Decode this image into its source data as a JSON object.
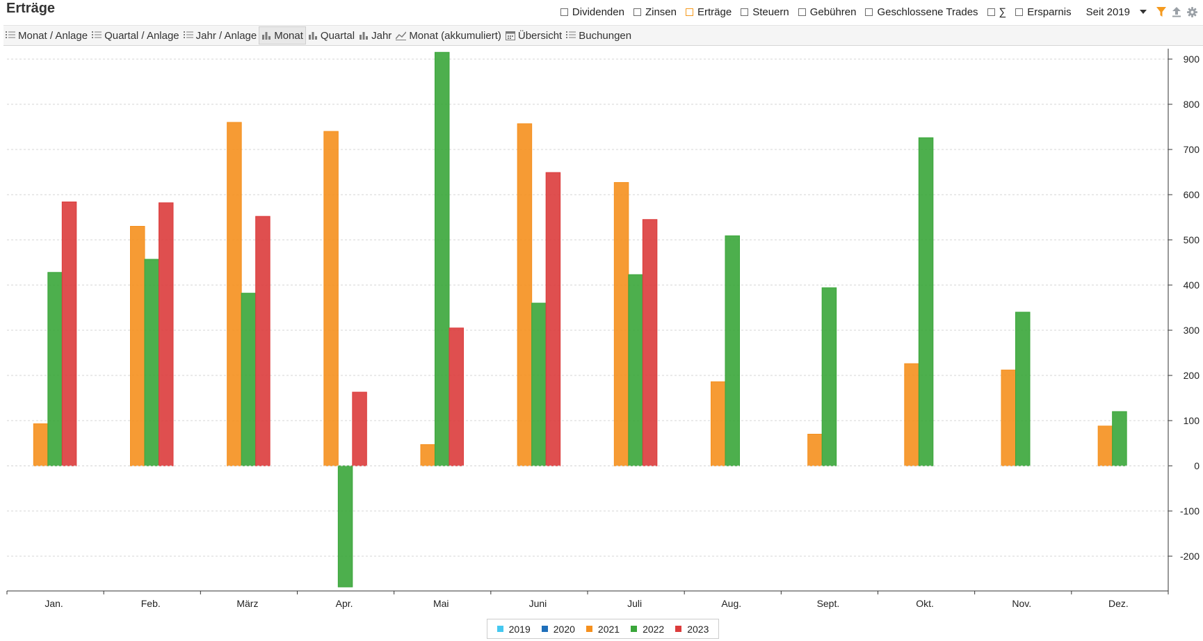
{
  "page_title": "Erträge",
  "filters": [
    {
      "label": "Dividenden",
      "checked": false
    },
    {
      "label": "Zinsen",
      "checked": false
    },
    {
      "label": "Erträge",
      "checked": true
    },
    {
      "label": "Steuern",
      "checked": false
    },
    {
      "label": "Gebühren",
      "checked": false
    },
    {
      "label": "Geschlossene Trades",
      "checked": false
    },
    {
      "label": "∑",
      "checked": false
    },
    {
      "label": "Ersparnis",
      "checked": false
    }
  ],
  "period_select": "Seit 2019",
  "tabs": [
    {
      "label": "Monat / Anlage",
      "icon": "list-icon"
    },
    {
      "label": "Quartal / Anlage",
      "icon": "list-icon"
    },
    {
      "label": "Jahr / Anlage",
      "icon": "list-icon"
    },
    {
      "label": "Monat",
      "icon": "bar-chart-icon",
      "active": true
    },
    {
      "label": "Quartal",
      "icon": "bar-chart-icon"
    },
    {
      "label": "Jahr",
      "icon": "bar-chart-icon"
    },
    {
      "label": "Monat (akkumuliert)",
      "icon": "line-chart-icon"
    },
    {
      "label": "Übersicht",
      "icon": "calendar-icon"
    },
    {
      "label": "Buchungen",
      "icon": "list-icon"
    }
  ],
  "colors": {
    "accent": "#f59a1e",
    "filter_icon": "#f59a1e"
  },
  "chart_data": {
    "type": "bar",
    "categories": [
      "Jan.",
      "Feb.",
      "März",
      "Apr.",
      "Mai",
      "Juni",
      "Juli",
      "Aug.",
      "Sept.",
      "Okt.",
      "Nov.",
      "Dez."
    ],
    "series": [
      {
        "name": "2019",
        "color": "#45c8f0",
        "values": [
          0,
          0,
          0,
          0,
          0,
          0,
          0,
          0,
          0,
          0,
          0,
          0
        ]
      },
      {
        "name": "2020",
        "color": "#1f6fba",
        "values": [
          0,
          0,
          0,
          0,
          0,
          0,
          0,
          0,
          0,
          0,
          0,
          0
        ]
      },
      {
        "name": "2021",
        "color": "#f5901e",
        "values": [
          93,
          530,
          760,
          740,
          47,
          757,
          627,
          186,
          70,
          226,
          212,
          88
        ]
      },
      {
        "name": "2022",
        "color": "#3aa63a",
        "values": [
          428,
          457,
          382,
          -268,
          915,
          360,
          423,
          509,
          394,
          726,
          340,
          120
        ]
      },
      {
        "name": "2023",
        "color": "#dc3c3c",
        "values": [
          584,
          582,
          552,
          163,
          305,
          649,
          545,
          null,
          null,
          null,
          null,
          null
        ]
      }
    ],
    "yticks": [
      -200,
      -100,
      0,
      100,
      200,
      300,
      400,
      500,
      600,
      700,
      800,
      900
    ],
    "ylim": [
      -280,
      925
    ],
    "grid": true,
    "legend_position": "bottom-center"
  }
}
